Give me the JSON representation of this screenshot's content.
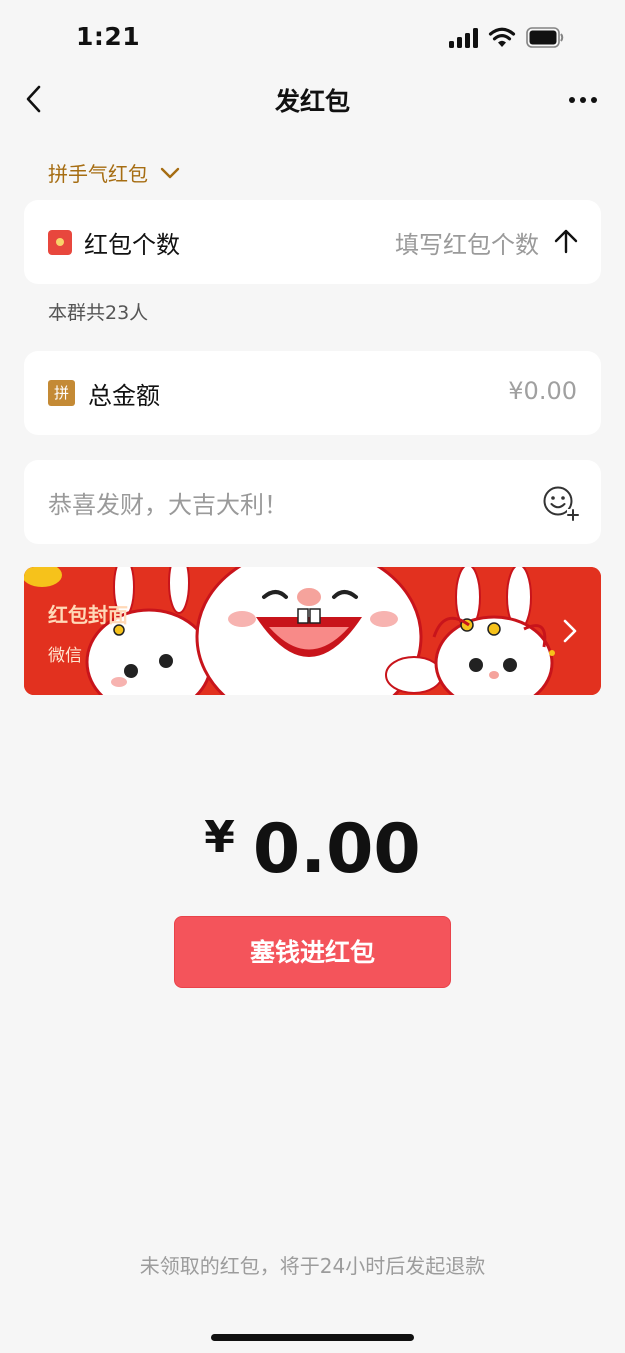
{
  "status_bar": {
    "time": "1:21"
  },
  "nav": {
    "title": "发红包"
  },
  "packet_type": {
    "label": "拼手气红包"
  },
  "count_row": {
    "label": "红包个数",
    "placeholder": "填写红包个数"
  },
  "group_info": {
    "text": "本群共23人"
  },
  "amount_row": {
    "badge": "拼",
    "label": "总金额",
    "value": "¥0.00"
  },
  "greeting": {
    "placeholder": "恭喜发财，大吉大利！"
  },
  "cover": {
    "label": "红包封面",
    "sub": "微信"
  },
  "total": {
    "currency": "¥",
    "value": "0.00"
  },
  "submit": {
    "label": "塞钱进红包"
  },
  "footer": {
    "note": "未领取的红包，将于24小时后发起退款"
  },
  "colors": {
    "accent_red": "#f4545b",
    "gold": "#a66d12",
    "cover_red": "#e2311f"
  }
}
